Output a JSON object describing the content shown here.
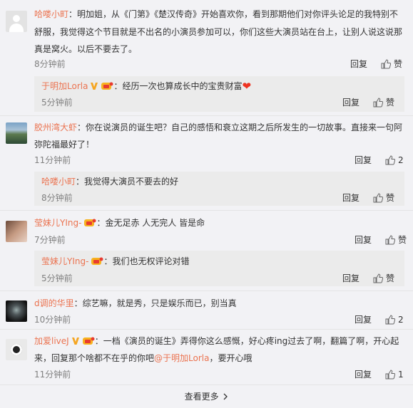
{
  "comments": [
    {
      "name": "哈喽小町",
      "text1": "：明加姐，从《门第》《楚汉传奇》开始喜欢你，看到那期他们对你评头论足的我特别不",
      "text2": "舒服，我觉得这个节目就是不出名的小演员参加可以，你们这些大演员站在台上，让别人说这说那",
      "text3": "真是窝火。以后不要去了。",
      "time": "8分钟前",
      "reply": "回复",
      "like": "赞",
      "sub": {
        "name": "于明加Lorla",
        "text": "：经历一次也算成长中的宝贵财富",
        "heart": "❤",
        "time": "5分钟前",
        "reply": "回复",
        "like": "赞"
      }
    },
    {
      "name": "胶州湾大虾",
      "text1": "：你在说演员的诞生吧？自己的感悟和衰立这期之后所发生的一切故事。直接来一句阿",
      "text2": "弥陀福最好了！",
      "time": "11分钟前",
      "reply": "回复",
      "like": "2",
      "sub": {
        "name": "哈喽小町",
        "text": "：我觉得大演员不要去的好",
        "time": "8分钟前",
        "reply": "回复",
        "like": "赞"
      }
    },
    {
      "name": "莹妹儿YIng-",
      "text1": "：金无足赤  人无完人  皆是命",
      "time": "7分钟前",
      "reply": "回复",
      "like": "赞",
      "sub": {
        "name": "莹妹儿YIng-",
        "text": "：我们也无权评论对错",
        "time": "5分钟前",
        "reply": "回复",
        "like": "赞"
      }
    },
    {
      "name": "d调的华里",
      "text1": "：综艺嘛，就是秀，只是娱乐而已，别当真",
      "time": "10分钟前",
      "reply": "回复",
      "like": "2"
    },
    {
      "name": "加爱liveJ",
      "text1": "：一档《演员的诞生》弄得你这么感慨，好心疼ing过去了啊，翻篇了啊，开心起",
      "text2a": "来，回复那个啥都不在乎的你吧",
      "mention": "@于明加Lorla",
      "text2b": "，要开心哦",
      "time": "11分钟前",
      "reply": "回复",
      "like": "1"
    }
  ],
  "load_more": "查看更多",
  "colors": {
    "name": "#eb7350",
    "time": "#808080",
    "subBg": "#ebebeb",
    "pageBg": "#f2f2f5"
  }
}
